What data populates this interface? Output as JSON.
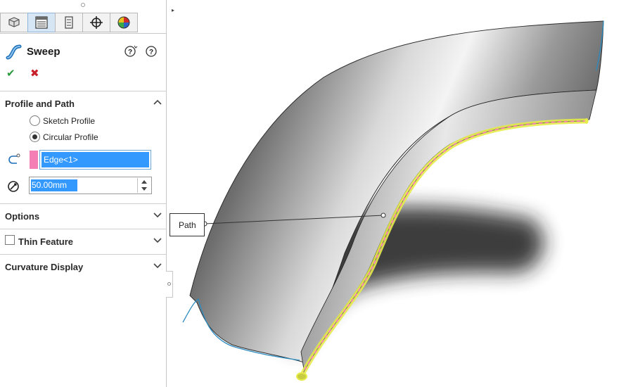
{
  "panel": {
    "tabs": [
      {
        "name": "feature-manager-tab",
        "icon": "feature-tree-icon"
      },
      {
        "name": "property-manager-tab",
        "icon": "property-list-icon"
      },
      {
        "name": "configuration-manager-tab",
        "icon": "configuration-icon"
      },
      {
        "name": "dimxpert-manager-tab",
        "icon": "crosshair-icon"
      },
      {
        "name": "display-manager-tab",
        "icon": "color-wheel-icon"
      }
    ],
    "active_tab": 1,
    "title": "Sweep",
    "ok_glyph": "✔",
    "cancel_glyph": "✖",
    "sections": {
      "profile_and_path": {
        "label": "Profile and Path",
        "expanded": true,
        "options": [
          {
            "label": "Sketch Profile",
            "selected": false
          },
          {
            "label": "Circular Profile",
            "selected": true
          }
        ],
        "path_value": "Edge<1>",
        "diameter_value": "50.00mm"
      },
      "options": {
        "label": "Options",
        "expanded": false
      },
      "thin_feature": {
        "label": "Thin Feature",
        "checked": false,
        "expanded": false
      },
      "curvature_display": {
        "label": "Curvature Display",
        "expanded": false
      }
    }
  },
  "viewport": {
    "callout_label": "Path",
    "colors": {
      "selection_pink": "#f47fb5",
      "highlight_yellow": "#f0f000",
      "edge_blue": "#2a8ac0"
    }
  }
}
